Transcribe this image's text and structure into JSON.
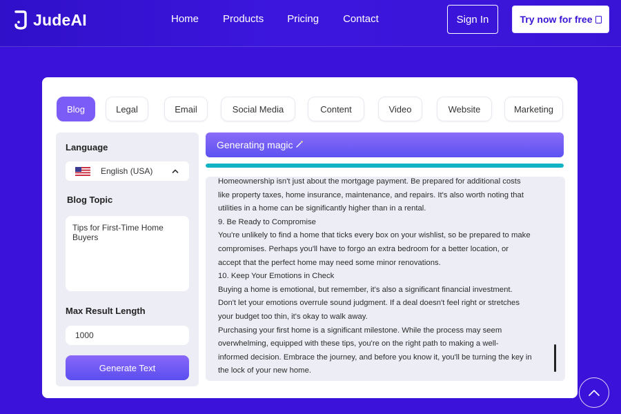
{
  "brand": {
    "name": "JudeAI"
  },
  "nav": {
    "home": "Home",
    "products": "Products",
    "pricing": "Pricing",
    "contact": "Contact"
  },
  "header_buttons": {
    "sign_in": "Sign In",
    "try_now": "Try now for free",
    "try_now_icon": "external-link-icon"
  },
  "tabs": [
    "Blog",
    "Legal",
    "Email",
    "Social Media",
    "Content",
    "Video",
    "Website",
    "Marketing"
  ],
  "active_tab": "Blog",
  "sidebar": {
    "language_label": "Language",
    "language_value": "English (USA)",
    "language_icon": "us-flag-icon",
    "topic_label": "Blog Topic",
    "topic_value": "Tips for First-Time Home Buyers",
    "max_length_label": "Max Result Length",
    "max_length_value": "1000",
    "generate_label": "Generate Text"
  },
  "status": {
    "message": "Generating magic",
    "icon": "magic-wand-icon",
    "progress": 1.0
  },
  "output_lines": [
    "Homeownership isn't just about the mortgage payment. Be prepared for additional costs",
    "like property taxes, home insurance, maintenance, and repairs. It's also worth noting that",
    "utilities in a home can be significantly higher than in a rental.",
    "9. Be Ready to Compromise",
    "You're unlikely to find a home that ticks every box on your wishlist, so be prepared to make",
    "compromises. Perhaps you'll have to forgo an extra bedroom for a better location, or",
    "accept that the perfect home may need some minor renovations.",
    "10. Keep Your Emotions in Check",
    "Buying a home is emotional, but remember, it's also a significant financial investment.",
    "Don't let your emotions overrule sound judgment. If a deal doesn't feel right or stretches",
    "your budget too thin, it's okay to walk away.",
    "Purchasing your first home is a significant milestone. While the process may seem",
    "overwhelming, equipped with these tips, you're on the right path to making a well-",
    "informed decision. Embrace the journey, and before you know it, you'll be turning the key in",
    "the lock of your new home."
  ],
  "colors": {
    "background": "#3a12d9",
    "accent": "#7c5cf6",
    "progress": "#12b3c4"
  }
}
